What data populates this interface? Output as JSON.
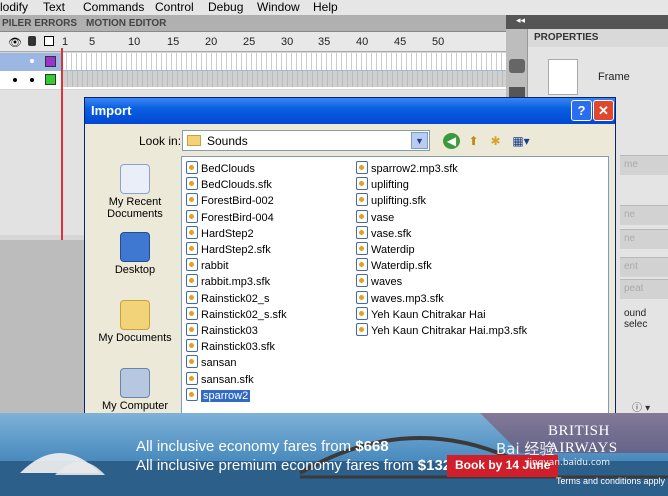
{
  "menubar": {
    "items": [
      "lodify",
      "Text",
      "Commands",
      "Control",
      "Debug",
      "Window",
      "Help"
    ]
  },
  "timeline": {
    "tabs": [
      "PILER ERRORS",
      "MOTION EDITOR"
    ],
    "frame_numbers": [
      "1",
      "5",
      "10",
      "15",
      "20",
      "25",
      "30",
      "35",
      "40",
      "45",
      "50"
    ],
    "layer_icons": [
      "eye-icon",
      "lock-icon",
      "outline-icon"
    ],
    "row1_color": "#9933cc",
    "row2_color": "#33cc33"
  },
  "right_panel": {
    "tab_label": "PROPERTIES",
    "frame_label": "Frame",
    "fields": [
      "me",
      "ne",
      "ne",
      "ent",
      "peat",
      "ound selec"
    ],
    "collapse_label": "◂◂"
  },
  "dialog": {
    "title": "Import",
    "help_label": "?",
    "close_label": "✕",
    "lookin_label": "Look in:",
    "lookin_value": "Sounds",
    "places": [
      {
        "label": "My Recent Documents",
        "icon": "recent-documents-icon"
      },
      {
        "label": "Desktop",
        "icon": "desktop-icon"
      },
      {
        "label": "My Documents",
        "icon": "my-documents-icon"
      },
      {
        "label": "My Computer",
        "icon": "my-computer-icon"
      }
    ],
    "files_col1": [
      "BedClouds",
      "BedClouds.sfk",
      "ForestBird-002",
      "ForestBird-004",
      "HardStep2",
      "HardStep2.sfk",
      "rabbit",
      "rabbit.mp3.sfk",
      "Rainstick02_s",
      "Rainstick02_s.sfk",
      "Rainstick03",
      "Rainstick03.sfk",
      "sansan",
      "sansan.sfk",
      "sparrow2"
    ],
    "files_col2": [
      "sparrow2.mp3.sfk",
      "uplifting",
      "uplifting.sfk",
      "vase",
      "vase.sfk",
      "Waterdip",
      "Waterdip.sfk",
      "waves",
      "waves.mp3.sfk",
      "Yeh Kaun Chitrakar Hai",
      "Yeh Kaun Chitrakar Hai.mp3.sfk"
    ],
    "selected_file": "sparrow2"
  },
  "ad": {
    "line1_prefix": "All inclusive economy fares from ",
    "line1_price": "$668",
    "line2_prefix": "All inclusive premium economy fares from ",
    "line2_price": "$1328",
    "book_label": "Book by 14 June",
    "brand": "BRITISH AIRWAYS",
    "terms": "Terms and conditions apply",
    "watermark": "Bai 经验",
    "watermark_url": "jingyan.baidu.com"
  },
  "colors": {
    "title_bar": "#0a5fe0",
    "selection": "#316ac5",
    "book_button": "#d01f2a"
  }
}
